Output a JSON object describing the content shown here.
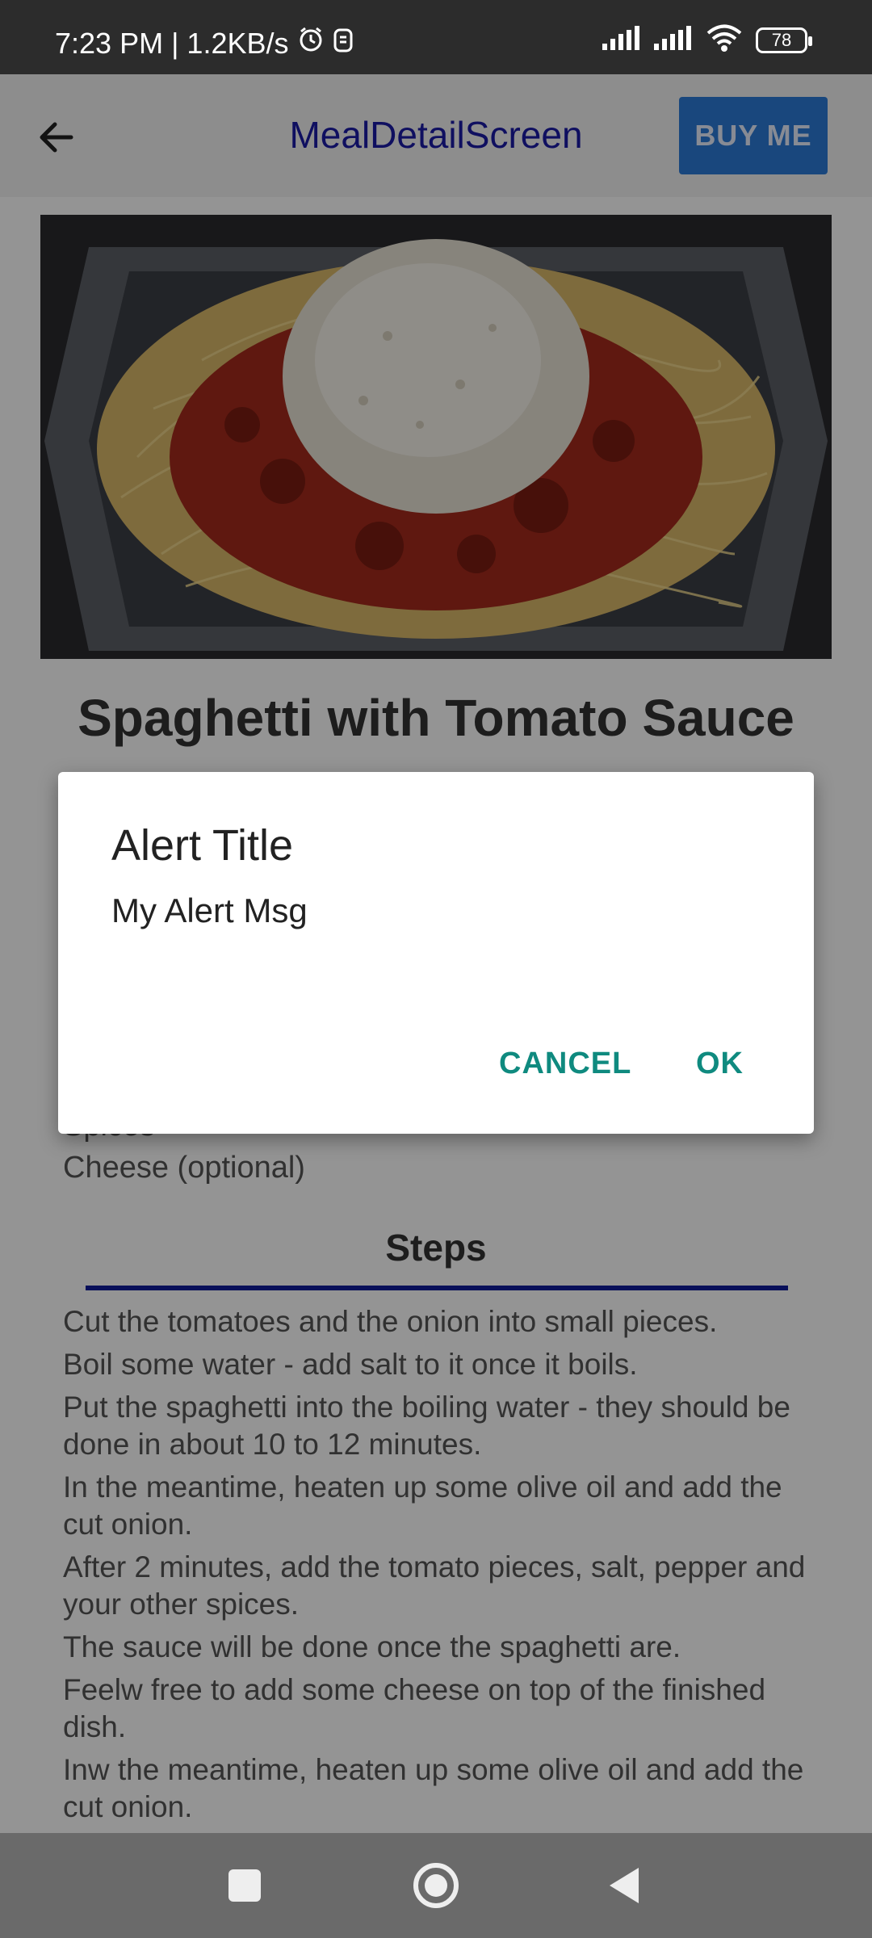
{
  "status_bar": {
    "time": "7:23 PM | 1.2KB/s",
    "battery_level": "78",
    "icons": [
      "alarm-icon",
      "sim-icon",
      "signal-icon",
      "signal-icon",
      "wifi-icon",
      "battery-icon"
    ]
  },
  "app_bar": {
    "title": "MealDetailScreen",
    "buy_label": "BUY ME",
    "back_icon": "arrow-left-icon"
  },
  "meal": {
    "title": "Spaghetti with Tomato Sauce",
    "ingredients_visible": [
      "Spices",
      "Cheese (optional)"
    ],
    "steps_title": "Steps",
    "steps": [
      "Cut the tomatoes and the onion into small pieces.",
      "Boil some water - add salt to it once it boils.",
      "Put the spaghetti into the boiling water - they should be done in about 10 to 12 minutes.",
      "In the meantime, heaten up some olive oil and add the cut onion.",
      "After 2 minutes, add the tomato pieces, salt, pepper and your other spices.",
      "The sauce will be done once the spaghetti are.",
      "Feelw free to add some cheese on top of the finished dish.",
      "Inw the meantime, heaten up some olive oil and add the cut onion."
    ]
  },
  "dialog": {
    "title": "Alert Title",
    "message": "My Alert Msg",
    "cancel_label": "CANCEL",
    "ok_label": "OK"
  },
  "colors": {
    "app_title": "#1a1aa6",
    "buy_button": "#2c7bd8",
    "dialog_buttons": "#0f8a7f",
    "section_line": "#0f1a9a"
  }
}
